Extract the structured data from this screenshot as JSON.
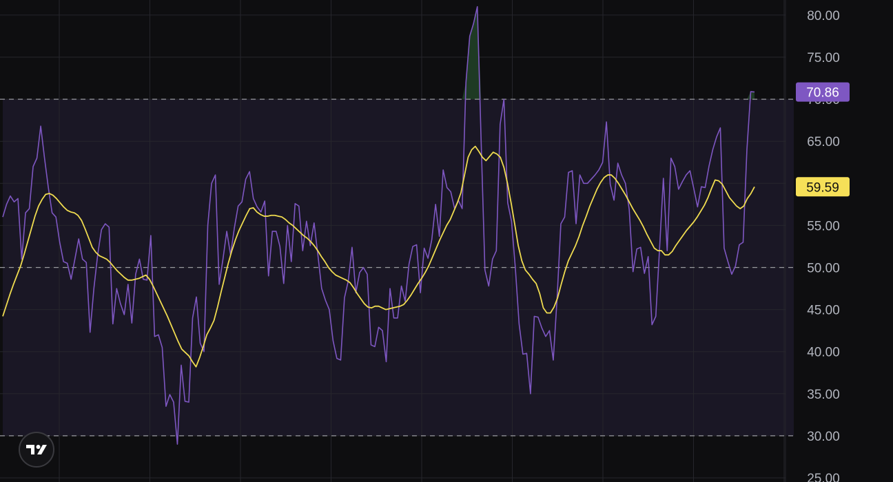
{
  "colors": {
    "background": "#0e0e10",
    "band_fill": "#1a1725",
    "grid": "#26262c",
    "rsi_line": "#7e57c2",
    "ma_line": "#f0dc50",
    "overbought_fill": "#1e3a24",
    "level_line": "#9a9aa0",
    "axis_text": "#b2b5be"
  },
  "logo_icon": "tradingview-logo-icon",
  "chart_data": {
    "type": "line",
    "ylim": [
      25,
      81.8
    ],
    "y_ticks": [
      "25.00",
      "30.00",
      "35.00",
      "40.00",
      "45.00",
      "50.00",
      "55.00",
      "60.00",
      "65.00",
      "70.00",
      "75.00",
      "80.00"
    ],
    "levels": {
      "upper": 70,
      "middle": 50,
      "lower": 30
    },
    "grid": true,
    "x_grid_count": 9,
    "series": [
      {
        "key": "rsi",
        "values": [
          56,
          57.5,
          58.5,
          57.8,
          58.2,
          51,
          56.5,
          57,
          62,
          63,
          66.8,
          63,
          59.5,
          56.5,
          56,
          53,
          50.7,
          50.5,
          48.6,
          51,
          53.4,
          51,
          50.6,
          42.3,
          47.5,
          51.5,
          54.5,
          55.2,
          54.8,
          43.3,
          47.5,
          45.7,
          44.4,
          48,
          43.4,
          49.2,
          51,
          48.6,
          48.5,
          53.8,
          41.8,
          42,
          40.5,
          33.5,
          34.9,
          34,
          29,
          38.4,
          34.1,
          34,
          44,
          46.5,
          41,
          40,
          55,
          60,
          61,
          48,
          51,
          54.3,
          51.5,
          54.7,
          57.3,
          57.8,
          60.5,
          61.4,
          58.2,
          57.2,
          56.6,
          57.9,
          49,
          54.3,
          54.3,
          52.5,
          48.1,
          55,
          50.7,
          57.6,
          57.3,
          52,
          55.5,
          52.6,
          55.3,
          51.5,
          47.5,
          46.1,
          45,
          41.3,
          39.2,
          39,
          46.4,
          48.4,
          52.4,
          47,
          49.4,
          50,
          49.2,
          40.8,
          40.6,
          42.9,
          42.5,
          38.8,
          47.5,
          44,
          44,
          47.8,
          46,
          50.4,
          52.5,
          52.7,
          47,
          52.3,
          51.1,
          53.3,
          57.5,
          53.7,
          61.6,
          59.5,
          59,
          57,
          58,
          57,
          72,
          77.5,
          79,
          81,
          65,
          49.7,
          47.8,
          51,
          52,
          67,
          70,
          57.7,
          55.5,
          50,
          43.3,
          39.7,
          39.8,
          35,
          44.2,
          44.1,
          42.8,
          41.8,
          42.5,
          39,
          46.3,
          55.2,
          56,
          61.3,
          61.5,
          55.2,
          61,
          60,
          60,
          60.5,
          61,
          61.6,
          62.5,
          67.3,
          59.9,
          58,
          62.4,
          61,
          60,
          56.9,
          49.5,
          52.2,
          52.4,
          49.3,
          51.3,
          43.2,
          44.2,
          52.3,
          60.6,
          52,
          63,
          62,
          59.3,
          60.2,
          61,
          61.5,
          59.4,
          57.2,
          59.6,
          59.5,
          62,
          64,
          65.5,
          66.6,
          52.3,
          50.7,
          49.2,
          50.2,
          52.7,
          53,
          64,
          70.9,
          70.86
        ]
      },
      {
        "key": "ma",
        "values": [
          44.2,
          45.5,
          46.8,
          48,
          49.1,
          50.2,
          51.6,
          53.1,
          54.6,
          56.1,
          57.3,
          58.1,
          58.7,
          58.8,
          58.6,
          58.2,
          57.7,
          57.2,
          56.8,
          56.6,
          56.5,
          56.2,
          55.6,
          54.6,
          53.5,
          52.4,
          51.8,
          51.4,
          51.2,
          51,
          50.6,
          50.1,
          49.6,
          49.2,
          48.8,
          48.5,
          48.5,
          48.6,
          48.7,
          48.9,
          49.1,
          48.6,
          47.8,
          46.9,
          46,
          45.1,
          44.2,
          43.2,
          42.2,
          41.2,
          40.3,
          39.9,
          39.5,
          38.8,
          38.2,
          39.3,
          40.6,
          42,
          42.8,
          43.7,
          45.3,
          47.1,
          48.8,
          50.5,
          52,
          53.3,
          54.4,
          55.3,
          56.2,
          57,
          57.1,
          56.6,
          56.3,
          56.1,
          56.1,
          56.2,
          56.2,
          56.1,
          56,
          55.7,
          55.3,
          55,
          54.6,
          54.2,
          53.8,
          53.5,
          53.1,
          52.6,
          52,
          51.3,
          50.7,
          50,
          49.5,
          49.1,
          48.9,
          48.7,
          48.5,
          48.2,
          47.6,
          46.9,
          46.3,
          45.7,
          45.3,
          45.2,
          45.4,
          45.4,
          45.2,
          45,
          45.1,
          45.2,
          45.3,
          45.4,
          45.6,
          46.1,
          46.7,
          47.4,
          48.1,
          48.7,
          49.4,
          50.2,
          51.2,
          52.2,
          53.2,
          54.1,
          55,
          55.7,
          56.7,
          57.7,
          58.9,
          61,
          63.1,
          64,
          64.4,
          63.8,
          63.1,
          62.7,
          63.2,
          63.7,
          63.5,
          63.1,
          61.9,
          60,
          57.7,
          55.2,
          52.6,
          50.8,
          49.7,
          49.2,
          48.6,
          48.1,
          46.9,
          45.2,
          44.6,
          44.6,
          45.3,
          46.4,
          48,
          49.5,
          50.8,
          51.7,
          52.6,
          53.7,
          55,
          56.1,
          57.3,
          58.3,
          59.3,
          60.1,
          60.7,
          61,
          61,
          60.6,
          60,
          59.3,
          58.6,
          57.8,
          57,
          56.3,
          55.6,
          54.8,
          53.9,
          53.1,
          52.3,
          52,
          52,
          51.5,
          51.5,
          51.9,
          52.6,
          53.2,
          53.8,
          54.4,
          54.9,
          55.4,
          56,
          56.7,
          57.4,
          58.3,
          59.4,
          60.4,
          60.3,
          59.9,
          59.1,
          58.3,
          57.8,
          57.3,
          57,
          57.3,
          58.2,
          58.8,
          59.59
        ]
      }
    ],
    "last_value_labels": [
      {
        "text": "70.86",
        "value": 70.86,
        "bg": "#7e57c2",
        "fg": "#ffffff"
      },
      {
        "text": "59.59",
        "value": 59.59,
        "bg": "#f6e058",
        "fg": "#111111"
      }
    ]
  }
}
